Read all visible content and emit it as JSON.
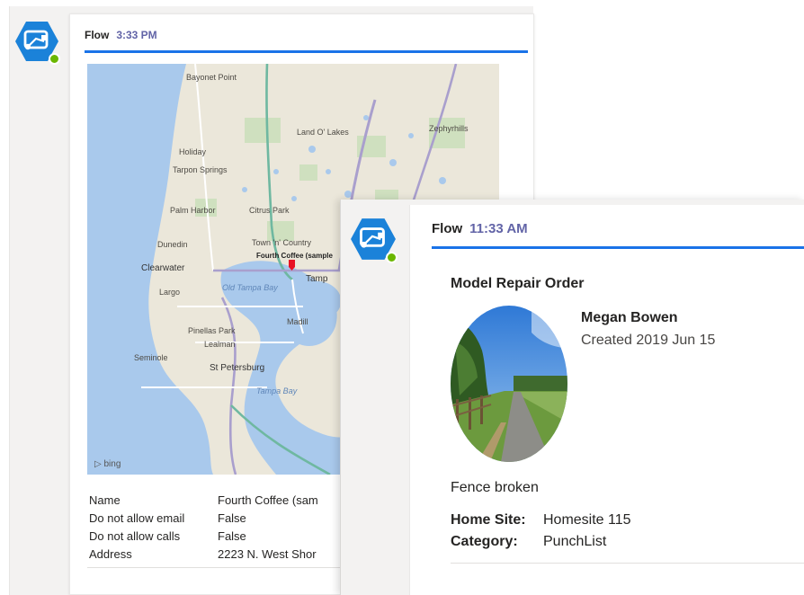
{
  "back_message": {
    "sender": "Flow",
    "time": "3:33 PM",
    "avatar_icon": "flow-icon",
    "map": {
      "attribution": "bing",
      "labels": {
        "bayonet_point": "Bayonet Point",
        "holiday": "Holiday",
        "tarpon_springs": "Tarpon Springs",
        "land_o_lakes": "Land O' Lakes",
        "zephyrhills": "Zephyrhills",
        "palm_harbor": "Palm Harbor",
        "citrus_park": "Citrus Park",
        "dunedin": "Dunedin",
        "town_n_country": "Town 'n' Country",
        "clearwater": "Clearwater",
        "largo": "Largo",
        "old_tampa_bay": "Old Tampa Bay",
        "tampa": "Tamp",
        "pinellas_park": "Pinellas Park",
        "seminole": "Seminole",
        "lealman": "Lealman",
        "st_petersburg": "St Petersburg",
        "tampa_bay": "Tampa Bay",
        "madill": "Madill",
        "pin": "Fourth Coffee (sample"
      },
      "pin_color": "#e81123"
    },
    "facts": [
      {
        "key": "Name",
        "value": "Fourth Coffee (sam"
      },
      {
        "key": "Do not allow email",
        "value": "False"
      },
      {
        "key": "Do not allow calls",
        "value": "False"
      },
      {
        "key": "Address",
        "value": "2223 N. West Shor"
      }
    ]
  },
  "front_message": {
    "sender": "Flow",
    "time": "11:33 AM",
    "avatar_icon": "flow-icon",
    "card": {
      "title": "Model Repair Order",
      "person": "Megan Bowen",
      "created": "Created 2019 Jun 15",
      "description": "Fence broken",
      "facts": [
        {
          "key": "Home Site:",
          "value": "Homesite 115"
        },
        {
          "key": "Category:",
          "value": "PunchList"
        }
      ]
    }
  },
  "colors": {
    "accent_line": "#1a73e8",
    "time_text": "#6264a7",
    "avatar": "#1b82d9",
    "presence": "#6bb700"
  }
}
